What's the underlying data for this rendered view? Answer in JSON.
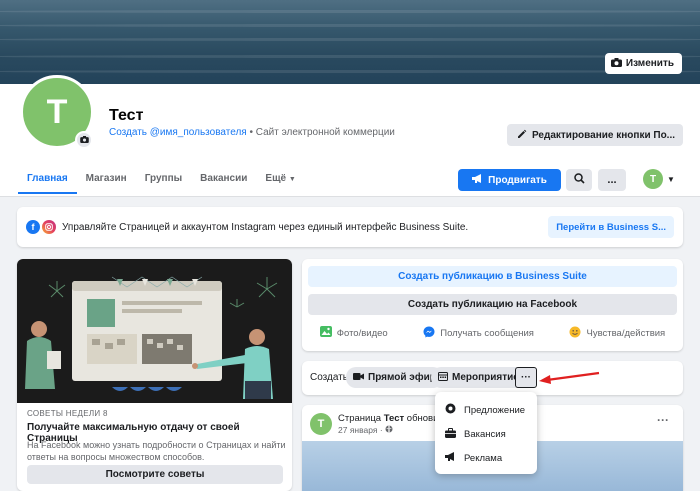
{
  "cover": {
    "change_label": "Изменить"
  },
  "page": {
    "avatar_letter": "T",
    "name": "Тест",
    "username_link": "Создать @имя_пользователя",
    "category": " • Сайт электронной коммерции",
    "edit_button_label": "Редактирование кнопки По..."
  },
  "tabs": [
    {
      "label": "Главная"
    },
    {
      "label": "Магазин"
    },
    {
      "label": "Группы"
    },
    {
      "label": "Вакансии"
    },
    {
      "label": "Ещё"
    }
  ],
  "toolbar": {
    "promote_label": "Продвигать",
    "more_label": "...",
    "profile_letter": "T"
  },
  "business_suite": {
    "text": "Управляйте Страницей и аккаунтом Instagram через единый интерфейс Business Suite.",
    "button_label": "Перейти в Business S..."
  },
  "tips": {
    "week_label": "СОВЕТЫ НЕДЕЛИ 8",
    "title": "Получайте максимальную отдачу от своей Страницы",
    "description": "На Facebook можно узнать подробности о Страницах и найти ответы на вопросы множеством способов.",
    "button_label": "Посмотрите советы"
  },
  "composer": {
    "business_suite_label": "Создать публикацию в Business Suite",
    "facebook_label": "Создать публикацию на Facebook",
    "actions": [
      {
        "label": "Фото/видео",
        "icon": "photo-icon"
      },
      {
        "label": "Получать сообщения",
        "icon": "messenger-icon"
      },
      {
        "label": "Чувства/действия",
        "icon": "smile-icon"
      }
    ]
  },
  "create_bar": {
    "label": "Создать",
    "live_label": "Прямой эфир",
    "event_label": "Мероприятие",
    "more_label": "···"
  },
  "dropdown": {
    "items": [
      {
        "label": "Предложение",
        "icon": "offer-icon"
      },
      {
        "label": "Вакансия",
        "icon": "briefcase-icon"
      },
      {
        "label": "Реклама",
        "icon": "megaphone-icon"
      }
    ]
  },
  "post": {
    "avatar_letter": "T",
    "title_prefix": "Страница ",
    "title_name": "Тест",
    "title_suffix": " обновила с",
    "date": "27 января · ",
    "more_label": "···"
  },
  "colors": {
    "accent": "#1877f2",
    "avatar_green": "#80c26b",
    "arrow_red": "#e02020"
  }
}
